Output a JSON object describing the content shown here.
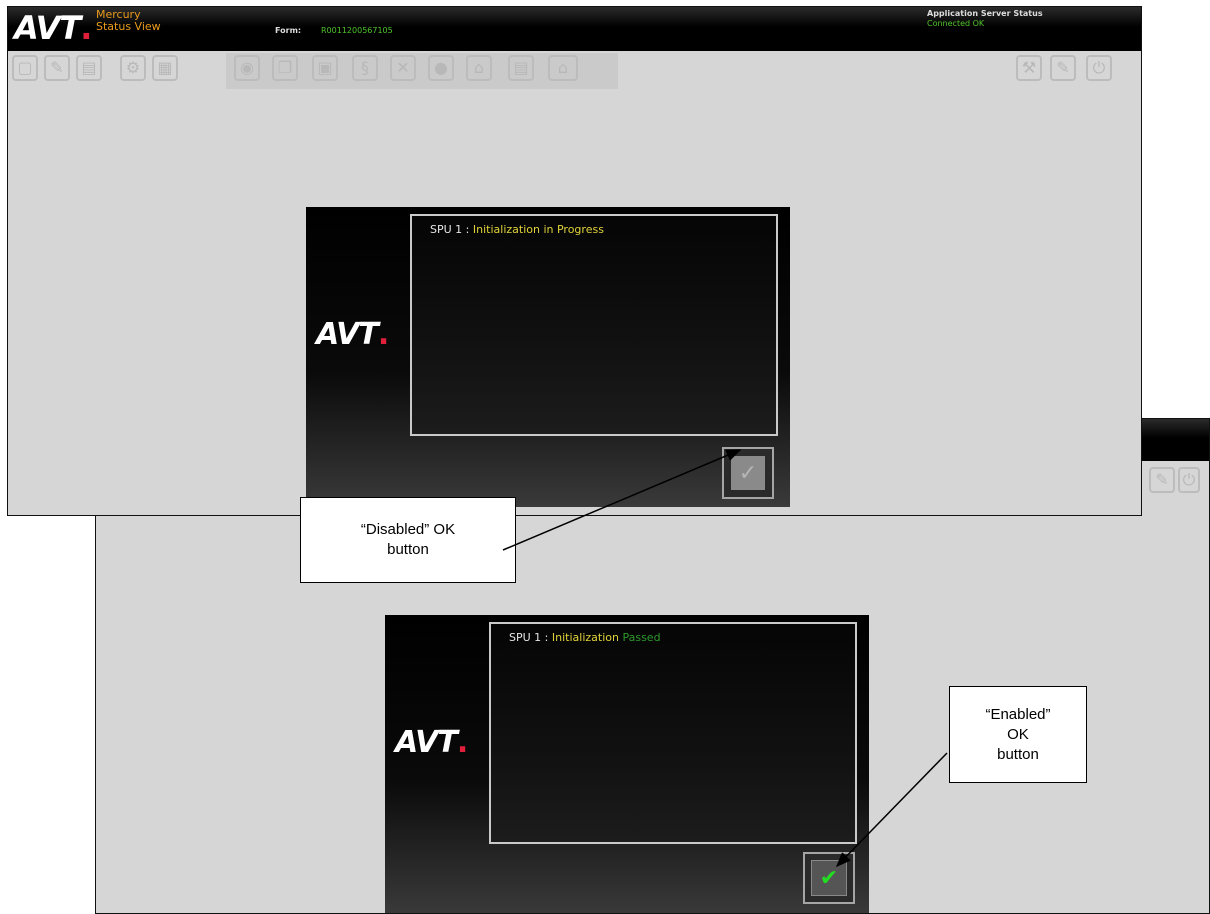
{
  "app": {
    "logo": "AVT",
    "name": "Mercury",
    "view": "Status View",
    "form_label": "Form:",
    "form_value": "R0011200567105",
    "server_status_label": "Application Server Status",
    "server_status_value": "Connected OK"
  },
  "toolbar": {
    "left_icons": [
      "new-icon",
      "edit-icon",
      "save-icon",
      "settings-icon",
      "print-icon"
    ],
    "center_icons": [
      "globe-icon",
      "copy-icon",
      "paste-icon",
      "link-icon",
      "zoom-icon",
      "disc-icon",
      "lock-icon",
      "document-icon",
      "factory-icon"
    ],
    "right_icons": [
      "tools-icon",
      "wrench-icon",
      "power-icon"
    ]
  },
  "dialog_disabled": {
    "unit": "SPU 1 :",
    "status": "Initialization in Progress",
    "ok_state": "disabled"
  },
  "dialog_enabled": {
    "unit": "SPU 1 :",
    "status": "Initialization",
    "result": "Passed",
    "ok_state": "enabled"
  },
  "callouts": {
    "disabled": "“Disabled” OK\nbutton",
    "enabled": "“Enabled”\nOK\nbutton"
  },
  "colors": {
    "accent_orange": "#e89a1c",
    "status_green": "#4fc32a",
    "status_yellow": "#e0d33a",
    "logo_red": "#e0203a",
    "background_gray": "#d6d6d6"
  }
}
